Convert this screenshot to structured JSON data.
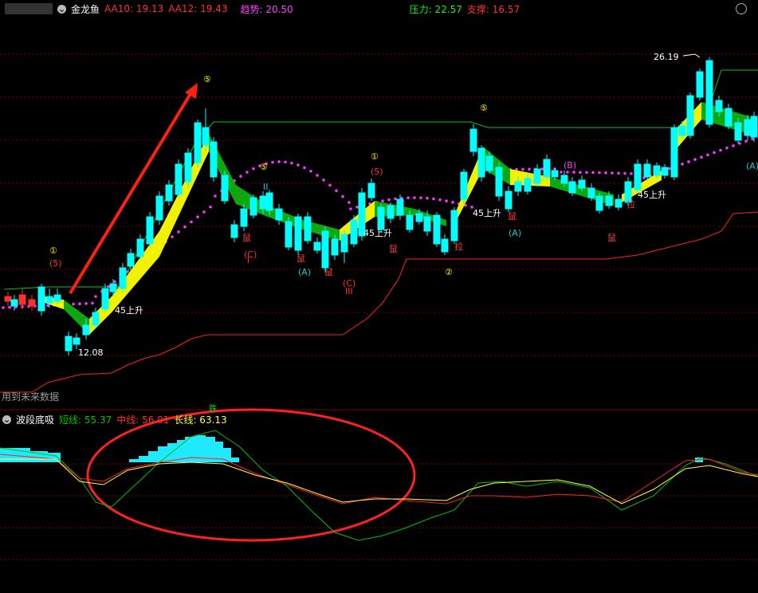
{
  "main": {
    "indicator_name": "金龙鱼",
    "aa10_label": "AA10: 19.13",
    "aa12_label": "AA12: 19.43",
    "trend_label": "趋势: 20.50",
    "pressure_label": "压力: 22.57",
    "support_label": "支撑: 16.57",
    "future_note": "用到未来数据",
    "peak_price": "26.19",
    "low_price": "12.08",
    "annotations": {
      "rise45": "45上升",
      "rat": "鼠",
      "pull": "拉",
      "circle5": "⑤",
      "circle1": "①",
      "circle2": "②",
      "paren5": "(5)",
      "parenC": "(C)",
      "parenA": "(A)",
      "parenB": "(B)",
      "roman1": "I",
      "roman2": "II",
      "roman3": "III",
      "diexin": "跌"
    }
  },
  "sub": {
    "indicator_name": "波段底吸",
    "short_label": "短线: 55.37",
    "mid_label": "中线: 56.01",
    "long_label": "长线: 63.13"
  },
  "colors": {
    "up": "#ff3030",
    "down": "#00ffff",
    "grid": "#800000",
    "green": "#10b010",
    "yellow": "#ffff00",
    "magenta": "#ff33ff",
    "arrow": "#ff2010",
    "short": "#00cc00",
    "mid": "#ff2020",
    "long": "#ffff40"
  }
}
